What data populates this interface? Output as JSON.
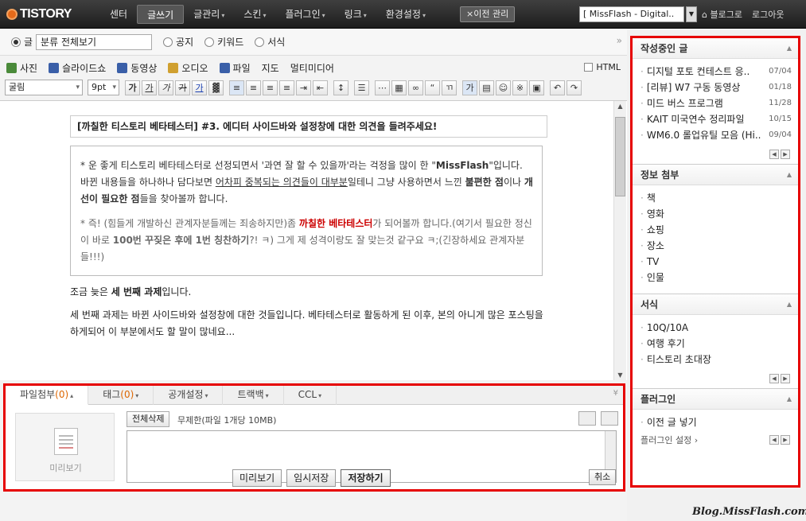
{
  "topnav": {
    "logo": "TISTORY",
    "items": [
      {
        "label": "센터",
        "caret": false,
        "active": false
      },
      {
        "label": "글쓰기",
        "caret": false,
        "active": true
      },
      {
        "label": "글관리",
        "caret": true,
        "active": false
      },
      {
        "label": "스킨",
        "caret": true,
        "active": false
      },
      {
        "label": "플러그인",
        "caret": true,
        "active": false
      },
      {
        "label": "링크",
        "caret": true,
        "active": false
      },
      {
        "label": "환경설정",
        "caret": true,
        "active": false
      }
    ],
    "migrate": "×이전 관리",
    "blog_select": "[ MissFlash - Digital..",
    "links": [
      "⌂ 블로그로",
      "로그아웃"
    ]
  },
  "filter": {
    "radios": [
      {
        "label": "글",
        "checked": true
      },
      {
        "label": "공지",
        "checked": false
      },
      {
        "label": "키워드",
        "checked": false
      },
      {
        "label": "서식",
        "checked": false
      }
    ],
    "category": "분류 전체보기"
  },
  "media": {
    "items": [
      {
        "label": "사진",
        "color": "#4a8a3a"
      },
      {
        "label": "슬라이드쇼",
        "color": "#3a5fa8"
      },
      {
        "label": "동영상",
        "color": "#3a5fa8"
      },
      {
        "label": "오디오",
        "color": "#d0a030"
      },
      {
        "label": "파일",
        "color": "#3a5fa8"
      },
      {
        "label": "지도",
        "color": ""
      },
      {
        "label": "멀티미디어",
        "color": ""
      }
    ],
    "html_label": "HTML"
  },
  "toolbar": {
    "font": "굴림",
    "size": "9pt",
    "buttons": [
      "가",
      "가",
      "가",
      "가",
      "가"
    ]
  },
  "document": {
    "title": "[까칠한 티스토리 베타테스터] #3. 에디터 사이드바와 설정창에 대한 의견을 들려주세요!",
    "quote_p1_a": "* 운 좋게 티스토리 베타테스터로 선정되면서 '과연 잘 할 수 있을까'라는 걱정을 많이 한 \"",
    "quote_p1_b": "MissFlash",
    "quote_p1_c": "\"입니다. 바뀐 내용들을 하나하나 담다보면 ",
    "quote_p1_d": "어차피 중복되는 의견들이 대부분",
    "quote_p1_e": "일테니 그냥 사용하면서 느낀 ",
    "quote_p1_f": "불편한 점",
    "quote_p1_g": "이나 ",
    "quote_p1_h": "개선이 필요한 점",
    "quote_p1_i": "들을 찾아볼까 합니다.",
    "quote_p2_a": "* 즉! (힘들게 개발하신 관계자분들께는 죄송하지만)좀 ",
    "quote_p2_b": "까칠한 베타테스터",
    "quote_p2_c": "가 되어볼까 합니다.(여기서 필요한 정신이 바로 ",
    "quote_p2_d": "100번 꾸짖은 후에 1번 칭찬하기",
    "quote_p2_e": "?! ㅋ) 그게 제 성격이랑도 잘 맞는것 같구요 ㅋ;(긴장하세요 관계자분들!!!)",
    "para1_a": "조금 늦은 ",
    "para1_b": "세 번째 과제",
    "para1_c": "입니다.",
    "para2": "세 번째 과제는 바뀐 사이드바와 설정창에 대한 것들입니다. 베타테스터로 활동하게 된 이후, 본의 아니게 많은 포스팅을 하게되어 이 부분에서도 할 말이 많네요..."
  },
  "attach": {
    "tabs": [
      {
        "label": "파일첨부",
        "count": "(0)",
        "caret": "▴"
      },
      {
        "label": "태그",
        "count": "(0)",
        "caret": "▾"
      },
      {
        "label": "공개설정",
        "count": "",
        "caret": "▾"
      },
      {
        "label": "트랙백",
        "count": "",
        "caret": "▾"
      },
      {
        "label": "CCL",
        "count": "",
        "caret": "▾"
      }
    ],
    "delete_all": "전체삭제",
    "limit": "무제한(파일 1개당 10MB)",
    "preview": "미리보기"
  },
  "actions": {
    "preview": "미리보기",
    "temp_save": "임시저장",
    "save": "저장하기",
    "cancel": "취소"
  },
  "sidebar": {
    "drafts": {
      "title": "작성중인 글",
      "items": [
        {
          "title": "디지털 포토 컨테스트 응..",
          "date": "07/04"
        },
        {
          "title": "[리뷰] W7 구동 동영상",
          "date": "01/18"
        },
        {
          "title": "미드 버스 프로그램",
          "date": "11/28"
        },
        {
          "title": "KAIT 미국연수 정리파일",
          "date": "10/15"
        },
        {
          "title": "WM6.0 롤업유틸 모음 (Hi..",
          "date": "09/04"
        }
      ]
    },
    "info": {
      "title": "정보 첨부",
      "items": [
        "책",
        "영화",
        "쇼핑",
        "장소",
        "TV",
        "인물"
      ]
    },
    "templates": {
      "title": "서식",
      "items": [
        "10Q/10A",
        "여행 후기",
        "티스토리 초대장"
      ]
    },
    "plugins": {
      "title": "플러그인",
      "items": [
        "이전 글 넣기"
      ],
      "settings": "플러그인 설정 ›"
    }
  },
  "watermark": "Blog.MissFlash.com"
}
